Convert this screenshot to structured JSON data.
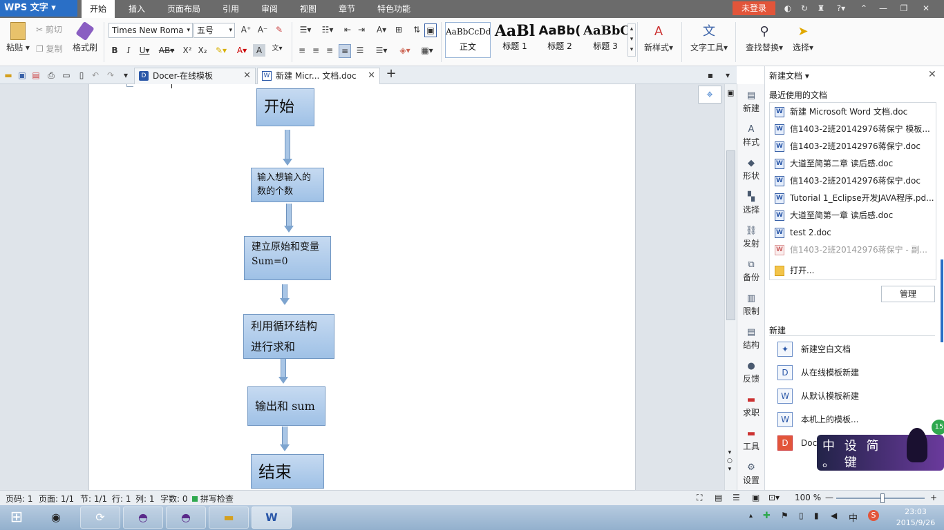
{
  "app": {
    "name": "WPS 文字"
  },
  "menu": {
    "tabs": [
      "开始",
      "插入",
      "页面布局",
      "引用",
      "审阅",
      "视图",
      "章节",
      "特色功能"
    ],
    "login": "未登录"
  },
  "ribbon": {
    "paste": "粘贴",
    "cut": "剪切",
    "copy": "复制",
    "format_painter": "格式刷",
    "font_name": "Times New Roma",
    "font_size": "五号",
    "styles": [
      {
        "preview": "AaBbCcDd",
        "name": "正文"
      },
      {
        "preview": "AaBl",
        "name": "标题 1"
      },
      {
        "preview": "AaBb(",
        "name": "标题 2"
      },
      {
        "preview": "AaBbC",
        "name": "标题 3"
      }
    ],
    "new_style": "新样式",
    "text_tools": "文字工具",
    "find_replace": "查找替换",
    "select": "选择"
  },
  "tabs": [
    {
      "label": "Docer-在线模板"
    },
    {
      "label": "新建 Micr... 文档.doc"
    }
  ],
  "flowchart": {
    "nodes": [
      "开始",
      "输入想输入的数的个数",
      "建立原始和变量 Sum=0",
      "利用循环结构进行求和",
      "输出和 sum",
      "结束"
    ]
  },
  "sidetools": [
    "新建",
    "样式",
    "形状",
    "选择",
    "发射",
    "备份",
    "限制",
    "结构",
    "反馈",
    "求职",
    "工具",
    "设置"
  ],
  "panel": {
    "title": "新建文档",
    "recent_header": "最近使用的文档",
    "recent": [
      "新建 Microsoft Word 文档.doc",
      "信1403-2班20142976蒋保宁 模板...",
      "信1403-2班20142976蒋保宁.doc",
      "大道至简第二章 读后感.doc",
      "信1403-2班20142976蒋保宁.doc",
      "Tutorial 1_Eclipse开发JAVA程序.pd...",
      "大道至简第一章 读后感.doc",
      "test 2.doc",
      "信1403-2班20142976蒋保宁 - 副..."
    ],
    "open": "打开...",
    "manage": "管理",
    "new_header": "新建",
    "new_items": [
      "新建空白文档",
      "从在线模板新建",
      "从默认模板新建",
      "本机上的模板...",
      "Doc"
    ]
  },
  "status": {
    "page": "页码: 1",
    "pages": "页面: 1/1",
    "section": "节: 1/1",
    "row": "行: 1",
    "col": "列: 1",
    "words": "字数: 0",
    "spell": "拼写检查",
    "zoom": "100 %"
  },
  "taskbar": {
    "time": "23:03",
    "date": "2015/9/26",
    "ime": "中"
  },
  "overlay": {
    "text1": "中 设 简",
    "text2": "。 键"
  }
}
